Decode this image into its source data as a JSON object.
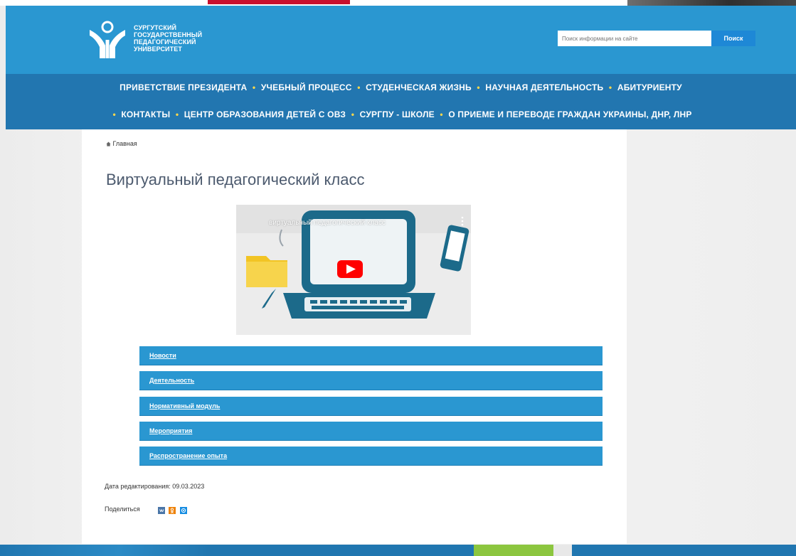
{
  "header": {
    "logo_lines": [
      "Сургутский",
      "Государственный",
      "Педагогический",
      "Университет"
    ],
    "search": {
      "placeholder": "Поиск информации на сайте",
      "button": "Поиск"
    }
  },
  "nav": {
    "row1": [
      "ПРИВЕТСТВИЕ ПРЕЗИДЕНТА",
      "УЧЕБНЫЙ ПРОЦЕСС",
      "СТУДЕНЧЕСКАЯ ЖИЗНЬ",
      "НАУЧНАЯ ДЕЯТЕЛЬНОСТЬ",
      "АБИТУРИЕНТУ"
    ],
    "row2": [
      "КОНТАКТЫ",
      "ЦЕНТР ОБРАЗОВАНИЯ ДЕТЕЙ С ОВЗ",
      "СУРГПУ - ШКОЛЕ",
      "О ПРИЕМЕ И ПЕРЕВОДЕ ГРАЖДАН УКРАИНЫ, ДНР, ЛНР"
    ],
    "bullet": "•"
  },
  "breadcrumb": {
    "icon": "home-icon",
    "label": "Главная"
  },
  "page": {
    "title": "Виртуальный педагогический класс",
    "video_title": "виртуальный педагогический класс"
  },
  "menu": {
    "items": [
      "Новости",
      "Деятельность",
      "Нормативный модуль",
      "Мероприятия",
      "Распространение опыта"
    ]
  },
  "meta": {
    "edit_date": "Дата редактирования: 09.03.2023",
    "share_label": "Поделиться"
  },
  "colors": {
    "header": "#2a97d1",
    "nav": "#2276b0",
    "menu": "#2a97d1",
    "youtube_red": "#ff0000"
  }
}
